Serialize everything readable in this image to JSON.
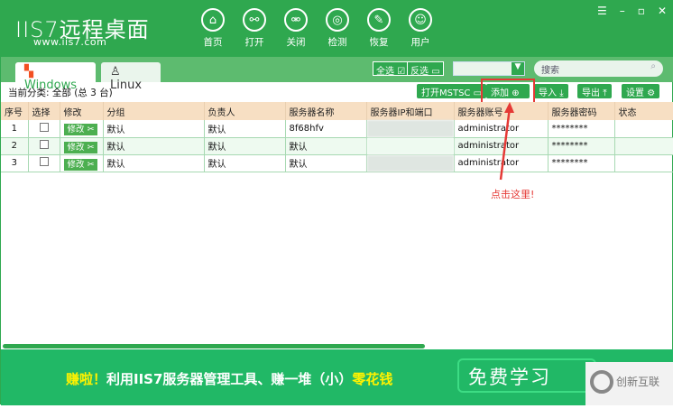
{
  "app": {
    "logo": "IIS7远程桌面",
    "url": "www.iis7.com"
  },
  "nav": [
    {
      "label": "首页",
      "icon": "home-icon"
    },
    {
      "label": "打开",
      "icon": "link-icon"
    },
    {
      "label": "关闭",
      "icon": "unlink-icon"
    },
    {
      "label": "检测",
      "icon": "radar-icon"
    },
    {
      "label": "恢复",
      "icon": "wrench-icon"
    },
    {
      "label": "用户",
      "icon": "user-icon"
    }
  ],
  "tabs": {
    "windows": "Windows",
    "linux": "Linux"
  },
  "toolbar": {
    "select_all": "全选",
    "invert": "反选",
    "dropdown": "",
    "search_placeholder": "搜索",
    "open_mstsc": "打开MSTSC",
    "add": "添加",
    "import": "导入",
    "export": "导出",
    "settings": "设置"
  },
  "crumb": "当前分类:  全部 (总 3 台)",
  "table": {
    "headers": [
      "序号",
      "选择",
      "修改",
      "分组",
      "负责人",
      "服务器名称",
      "服务器IP和端口",
      "服务器账号",
      "服务器密码",
      "状态"
    ],
    "edit_label": "修改 ✂",
    "rows": [
      [
        "1",
        "",
        "",
        "默认",
        "默认",
        "8f68hfv",
        "",
        "administrator",
        "********",
        ""
      ],
      [
        "2",
        "",
        "",
        "默认",
        "默认",
        "默认",
        "",
        "administrator",
        "********",
        ""
      ],
      [
        "3",
        "",
        "",
        "默认",
        "默认",
        "默认",
        "",
        "administrator",
        "********",
        ""
      ]
    ]
  },
  "annotation": "点击这里!",
  "banner": {
    "a": "赚啦！",
    "b": "利用IIS7服务器管理工具、赚一堆（小）",
    "c": "零花钱",
    "button": "免费学习"
  },
  "watermark": "创新互联",
  "colors": {
    "primary": "#2fa84f",
    "header_bg": "#f7dfc3",
    "highlight": "#e53935"
  }
}
